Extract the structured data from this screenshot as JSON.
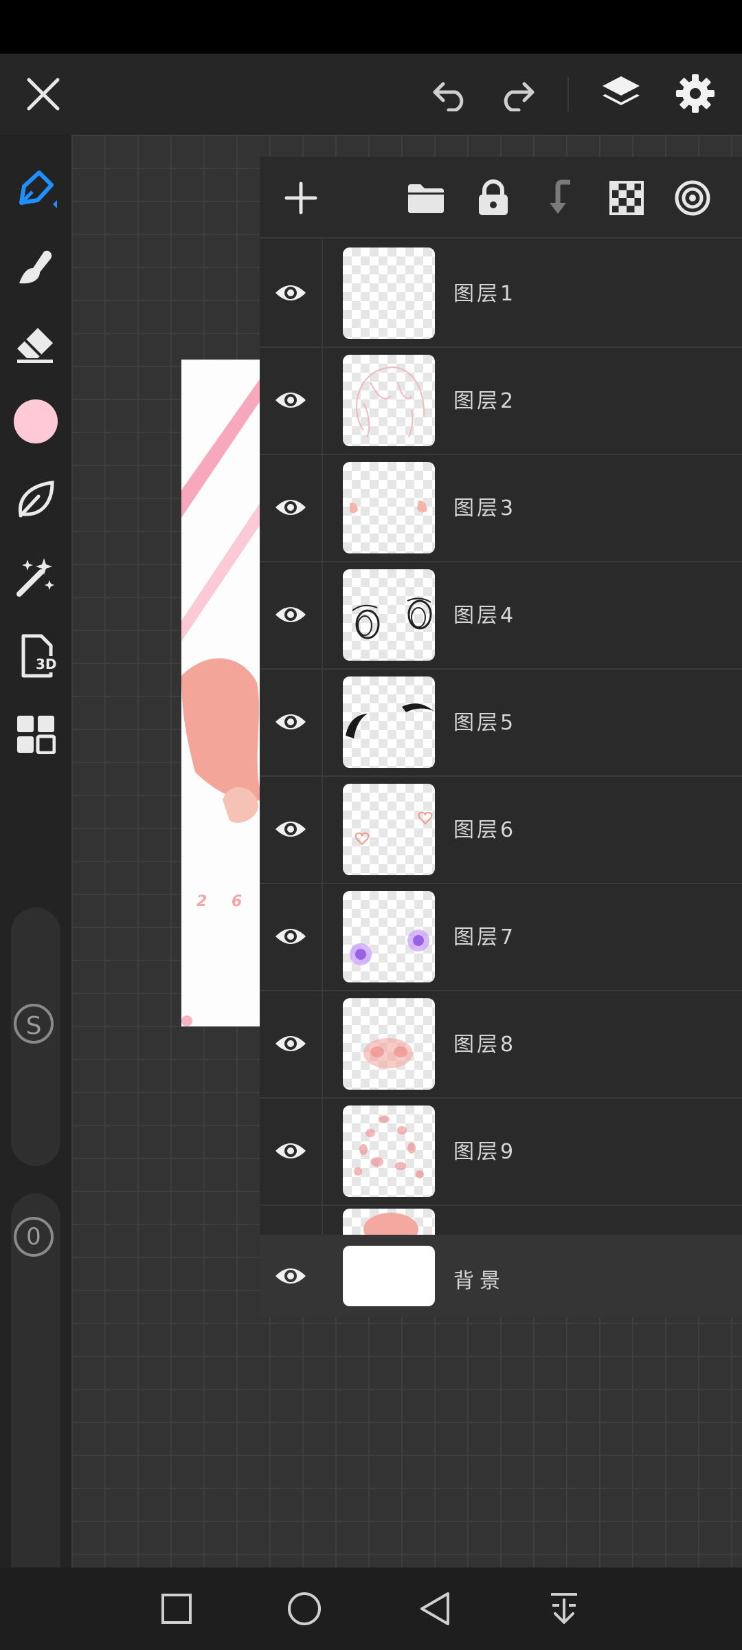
{
  "topbar": {
    "icons": [
      "close-icon",
      "undo-icon",
      "redo-icon",
      "layers-icon",
      "settings-icon"
    ]
  },
  "sidebar": {
    "tools": [
      "brush-icon",
      "smudge-icon",
      "eraser-icon",
      "color-swatch",
      "leaf-icon",
      "magic-wand-icon",
      "3d-icon",
      "grid-icon"
    ],
    "badge_3d": "3D",
    "size_slider_label": "S",
    "opacity_slider_label": "0",
    "color": "#ffcad6"
  },
  "layer_panel": {
    "toolbar_icons": [
      "add-icon",
      "folder-icon",
      "lock-icon",
      "merge-down-icon",
      "transparency-icon",
      "blend-mode-icon"
    ],
    "layers": [
      {
        "name": "图层1"
      },
      {
        "name": "图层2"
      },
      {
        "name": "图层3"
      },
      {
        "name": "图层4"
      },
      {
        "name": "图层5"
      },
      {
        "name": "图层6"
      },
      {
        "name": "图层7"
      },
      {
        "name": "图层8"
      },
      {
        "name": "图层9"
      }
    ],
    "background_layer": "背景"
  },
  "artwork": {
    "text": "2 6"
  },
  "navbar": {
    "icons": [
      "recent-apps-icon",
      "home-icon",
      "back-icon",
      "notification-down-icon"
    ]
  }
}
